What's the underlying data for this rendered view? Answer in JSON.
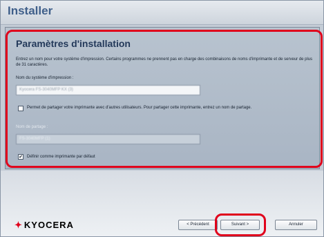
{
  "window": {
    "title": "Installer"
  },
  "section": {
    "heading": "Paramètres d'installation"
  },
  "description": "Entrez un nom pour votre système d'impression. Certains programmes ne prennent pas en charge des combinaisons de noms d'imprimante et de serveur de plus de 31 caractères.",
  "printer_name": {
    "label": "Nom du système d'impression :",
    "value": "Kyocera FS-3040MFP KX (3)"
  },
  "share": {
    "checkbox_label": "Permet de partager votre imprimante avec d'autres utilisateurs. Pour partager cette imprimante, entrez un nom de partage.",
    "checked": false
  },
  "share_name": {
    "label": "Nom de partage :",
    "value": "FS-3040MFP (1)"
  },
  "default_printer": {
    "checkbox_label": "Définir comme imprimante par défaut",
    "checked": true,
    "check_glyph": "✔"
  },
  "footer": {
    "brand": "KYOCERA",
    "buttons": {
      "previous": "< Précédent",
      "next": "Suivant >",
      "cancel": "Annuler"
    }
  },
  "colors": {
    "highlight": "#e0001b",
    "heading": "#23395a",
    "brand": "#e0001b"
  }
}
